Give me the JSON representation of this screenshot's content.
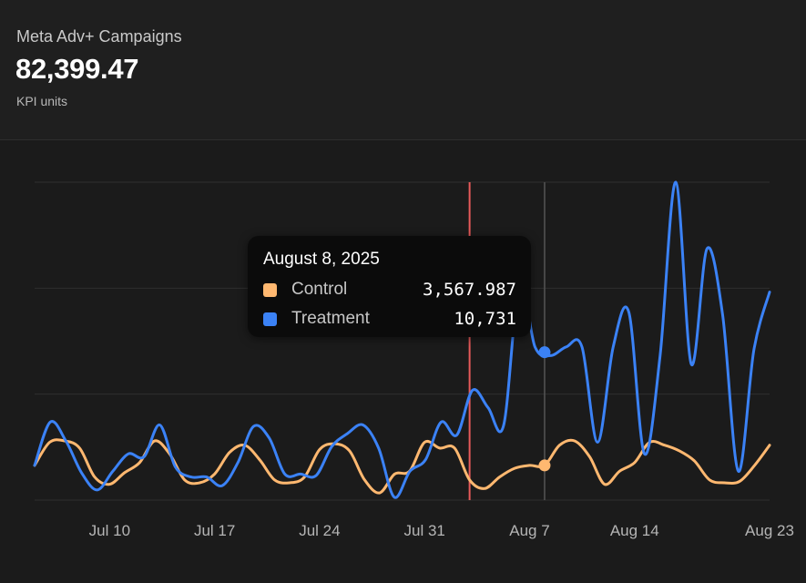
{
  "header": {
    "title": "Meta Adv+ Campaigns",
    "value": "82,399.47",
    "unit": "KPI units"
  },
  "tooltip": {
    "date": "August 8, 2025",
    "rows": [
      {
        "name": "Control",
        "value": "3,567.987",
        "color": "#ffb870"
      },
      {
        "name": "Treatment",
        "value": "10,731",
        "color": "#3b82f6"
      }
    ]
  },
  "chart_data": {
    "type": "line",
    "x": [
      "2025-07-05",
      "2025-07-06",
      "2025-07-07",
      "2025-07-08",
      "2025-07-09",
      "2025-07-10",
      "2025-07-11",
      "2025-07-12",
      "2025-07-13",
      "2025-07-14",
      "2025-07-15",
      "2025-07-16",
      "2025-07-17",
      "2025-07-18",
      "2025-07-19",
      "2025-07-20",
      "2025-07-21",
      "2025-07-22",
      "2025-07-23",
      "2025-07-24",
      "2025-07-25",
      "2025-07-26",
      "2025-07-27",
      "2025-07-28",
      "2025-07-29",
      "2025-07-30",
      "2025-07-31",
      "2025-08-01",
      "2025-08-02",
      "2025-08-03",
      "2025-08-04",
      "2025-08-05",
      "2025-08-06",
      "2025-08-07",
      "2025-08-08",
      "2025-08-09",
      "2025-08-10",
      "2025-08-11",
      "2025-08-12",
      "2025-08-13",
      "2025-08-14",
      "2025-08-15",
      "2025-08-16",
      "2025-08-17",
      "2025-08-18",
      "2025-08-19",
      "2025-08-20",
      "2025-08-21",
      "2025-08-22",
      "2025-08-23"
    ],
    "x_ticks": [
      "Jul 10",
      "Jul 17",
      "Jul 24",
      "Jul 31",
      "Aug 7",
      "Aug 14",
      "Aug 23"
    ],
    "series": [
      {
        "name": "Control",
        "color": "#ffb870",
        "values": [
          1200,
          2000,
          2050,
          1800,
          800,
          550,
          950,
          1300,
          2050,
          1600,
          700,
          600,
          900,
          1650,
          1900,
          1400,
          700,
          600,
          800,
          1750,
          1950,
          1700,
          700,
          250,
          900,
          1000,
          2000,
          1800,
          1800,
          700,
          400,
          800,
          1100,
          1200,
          1200,
          1900,
          2050,
          1500,
          550,
          1000,
          1300,
          2000,
          1900,
          1700,
          1350,
          700,
          600,
          650,
          1200,
          1900
        ]
      },
      {
        "name": "Treatment",
        "color": "#3b82f6",
        "values": [
          1200,
          2700,
          2050,
          950,
          350,
          1000,
          1600,
          1500,
          2600,
          1150,
          800,
          800,
          500,
          1300,
          2550,
          2150,
          900,
          900,
          850,
          1850,
          2300,
          2600,
          1800,
          100,
          1000,
          1400,
          2700,
          2250,
          3800,
          3200,
          2600,
          7500,
          5300,
          5000,
          5300,
          5300,
          2000,
          5300,
          6500,
          1600,
          5000,
          11000,
          4700,
          8700,
          6400,
          1000,
          5200,
          7200
        ]
      }
    ],
    "ylim": [
      0,
      11000
    ],
    "grid": true,
    "vertical_markers": [
      {
        "x": "2025-08-03",
        "color": "#e85a5a",
        "label": ""
      },
      {
        "x": "2025-08-08",
        "color": "#555555",
        "label": ""
      }
    ],
    "highlight_x": "2025-08-08"
  }
}
